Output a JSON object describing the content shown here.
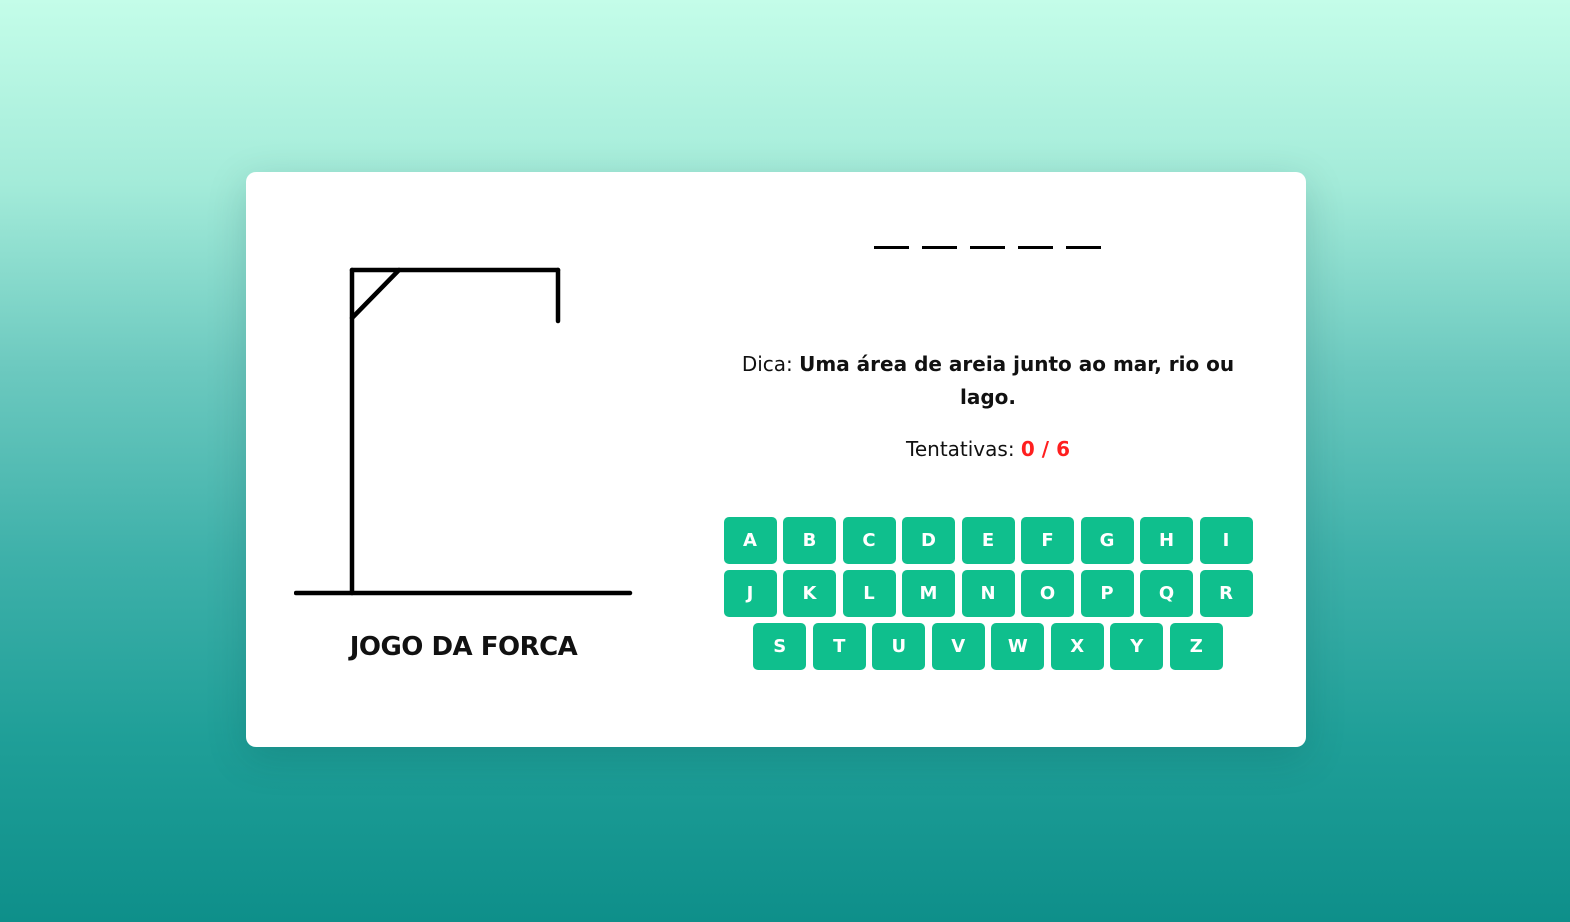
{
  "game": {
    "title": "JOGO DA FORCA",
    "word_slots": [
      "",
      "",
      "",
      "",
      ""
    ],
    "hint_label": "Dica:",
    "hint_text": "Uma área de areia junto ao mar, rio ou lago.",
    "tries_label": "Tentativas:",
    "tries_count": "0 / 6"
  },
  "keyboard": {
    "keys": [
      "A",
      "B",
      "C",
      "D",
      "E",
      "F",
      "G",
      "H",
      "I",
      "J",
      "K",
      "L",
      "M",
      "N",
      "O",
      "P",
      "Q",
      "R",
      "S",
      "T",
      "U",
      "V",
      "W",
      "X",
      "Y",
      "Z"
    ]
  },
  "colors": {
    "key_background": "#0fbf8d",
    "tries_count": "#ff1f1f",
    "card": "#ffffff",
    "gradient_top": "#c4fde9",
    "gradient_bottom": "#0e8f8a"
  },
  "icons": {
    "gallows": "hangman-gallows-icon"
  }
}
